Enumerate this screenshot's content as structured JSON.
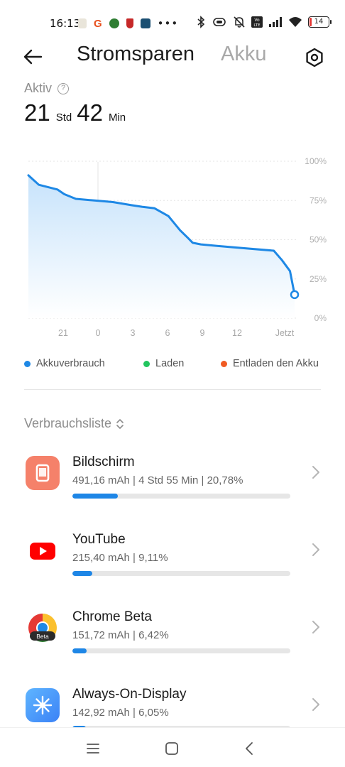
{
  "status_bar": {
    "time": "16:13",
    "overflow": "•••",
    "battery_level": "14",
    "icons": [
      "bluetooth-icon",
      "vibrate-icon",
      "mute-icon",
      "volte-icon",
      "signal-icon",
      "wifi-icon",
      "battery-icon"
    ]
  },
  "header": {
    "tab_active": "Stromsparen",
    "tab_inactive": "Akku"
  },
  "summary": {
    "label": "Aktiv",
    "help": "?",
    "hours": "21",
    "hours_unit": "Std",
    "minutes": "42",
    "minutes_unit": "Min"
  },
  "chart_data": {
    "type": "area",
    "y_ticks": [
      "100%",
      "75%",
      "50%",
      "25%",
      "0%"
    ],
    "x_ticks": [
      "21",
      "0",
      "3",
      "6",
      "9",
      "12",
      "Jetzt"
    ],
    "ylim": [
      0,
      100
    ],
    "x": [
      0,
      0.9,
      2.5,
      3.1,
      4.1,
      7.3,
      8.9,
      9.8,
      10.9,
      12.1,
      13.1,
      13.8,
      14.2,
      14.9,
      16.3,
      18,
      21.2,
      21.9,
      22.6,
      23
    ],
    "values": [
      91,
      85,
      82,
      79,
      76,
      74,
      72,
      71,
      70,
      65,
      56,
      51,
      48,
      47,
      46,
      45,
      43,
      37,
      30,
      15
    ],
    "line_color": "#1e88e5",
    "series": [
      {
        "name": "Akkuverbrauch",
        "color": "#1e88e5"
      },
      {
        "name": "Laden",
        "color": "#22c55e"
      },
      {
        "name": "Entladen den Akku",
        "color": "#f05a22"
      }
    ]
  },
  "section": {
    "title": "Verbrauchsliste",
    "sort_icon": "sort-updown-icon"
  },
  "apps": [
    {
      "name": "Bildschirm",
      "stats": "491,16 mAh | 4 Std 55 Min  | 20,78%",
      "progress": 0.2078,
      "icon": "screen-icon"
    },
    {
      "name": "YouTube",
      "stats": "215,40 mAh | 9,11%",
      "progress": 0.0911,
      "icon": "youtube-icon"
    },
    {
      "name": "Chrome Beta",
      "stats": "151,72 mAh | 6,42%",
      "progress": 0.0642,
      "icon": "chrome-beta-icon",
      "badge": "Beta"
    },
    {
      "name": "Always-On-Display",
      "stats": "142,92 mAh | 6,05%",
      "progress": 0.0605,
      "icon": "always-on-display-icon"
    }
  ],
  "colors": {
    "accent": "#1e86e6",
    "bildschirm_icon": "#f5816a",
    "youtube_red": "#ff0000",
    "aod_blue": "#4aa3f7"
  }
}
